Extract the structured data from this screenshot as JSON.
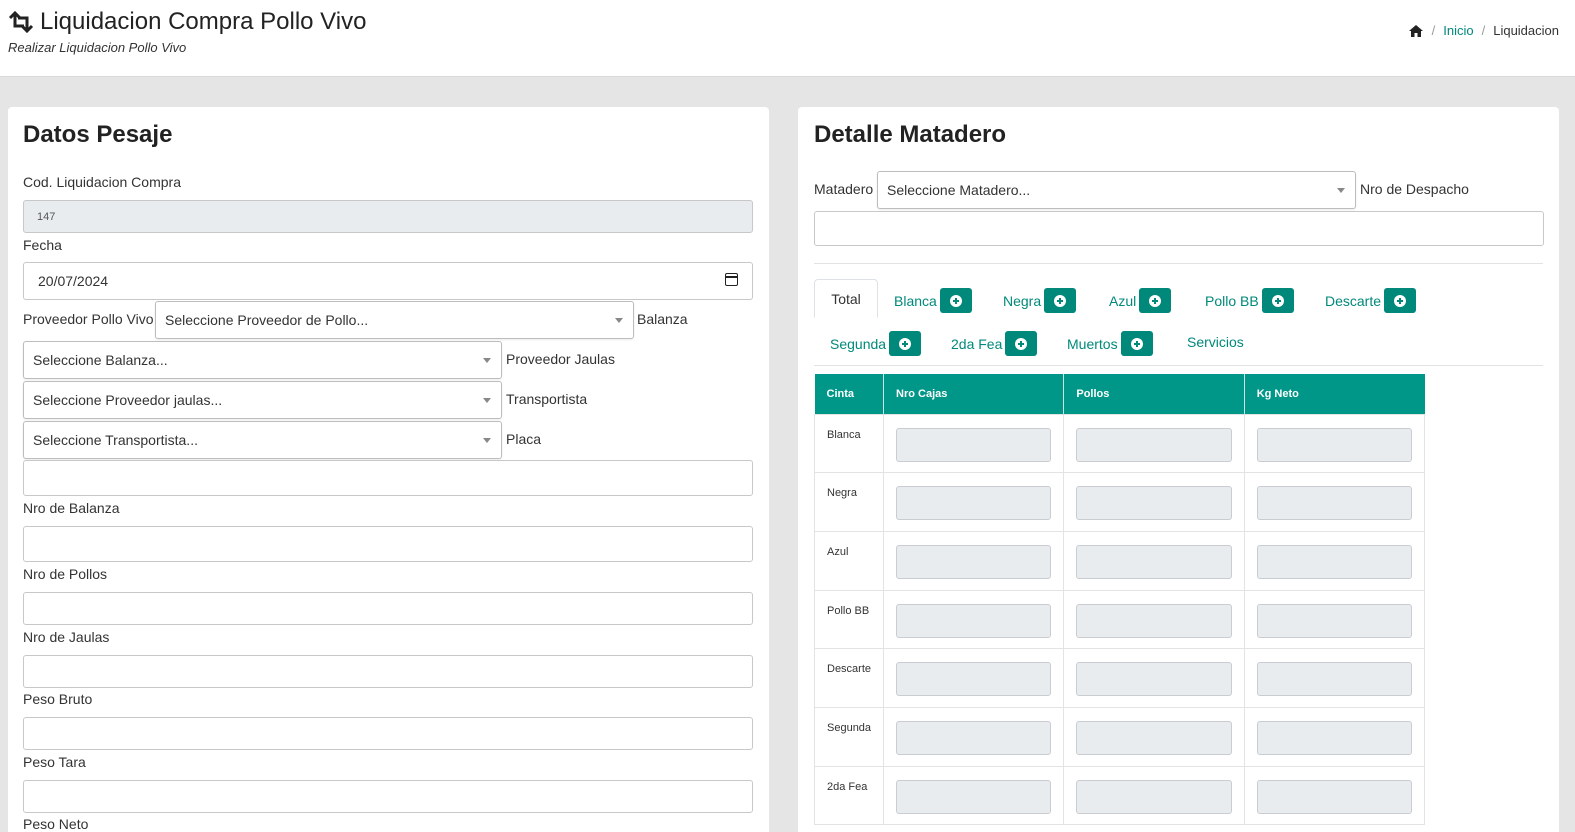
{
  "header": {
    "title": "Liquidacion Compra Pollo Vivo",
    "subtitle": "Realizar Liquidacion Pollo Vivo",
    "breadcrumb": {
      "inicio": "Inicio",
      "current": "Liquidacion"
    }
  },
  "left_panel": {
    "title": "Datos Pesaje",
    "cod_label": "Cod. Liquidacion Compra",
    "cod_value": "147",
    "fecha_label": "Fecha",
    "fecha_value": "20/07/2024",
    "proveedor_label": "Proveedor Pollo Vivo",
    "proveedor_placeholder": "Seleccione Proveedor de Pollo...",
    "balanza_label": "Balanza",
    "balanza_placeholder": "Seleccione Balanza...",
    "proveedor_jaulas_label": "Proveedor Jaulas",
    "proveedor_jaulas_placeholder": "Seleccione Proveedor jaulas...",
    "transportista_label": "Transportista",
    "transportista_placeholder": "Seleccione Transportista...",
    "placa_label": "Placa",
    "nro_balanza_label": "Nro de Balanza",
    "nro_pollos_label": "Nro de Pollos",
    "nro_jaulas_label": "Nro de Jaulas",
    "peso_bruto_label": "Peso Bruto",
    "peso_tara_label": "Peso Tara",
    "peso_neto_label": "Peso Neto"
  },
  "right_panel": {
    "title": "Detalle Matadero",
    "matadero_label": "Matadero",
    "matadero_placeholder": "Seleccione Matadero...",
    "nro_despacho_label": "Nro de Despacho",
    "tabs": [
      {
        "label": "Total"
      },
      {
        "label": "Blanca"
      },
      {
        "label": "Negra"
      },
      {
        "label": "Azul"
      },
      {
        "label": "Pollo BB"
      },
      {
        "label": "Descarte"
      },
      {
        "label": "Segunda"
      },
      {
        "label": "2da Fea"
      },
      {
        "label": "Muertos"
      },
      {
        "label": "Servicios"
      }
    ],
    "table": {
      "headers": [
        "Cinta",
        "Nro Cajas",
        "Pollos",
        "Kg Neto"
      ],
      "rows": [
        "Blanca",
        "Negra",
        "Azul",
        "Pollo BB",
        "Descarte",
        "Segunda",
        "2da Fea"
      ]
    }
  },
  "colors": {
    "accent": "#009688",
    "link": "#00897b"
  },
  "icons": {
    "title": "retweet-icon",
    "breadcrumb_home": "home-icon",
    "tab_add": "plus-circle-icon",
    "select_caret": "caret-down-icon",
    "date_picker": "calendar-icon"
  }
}
